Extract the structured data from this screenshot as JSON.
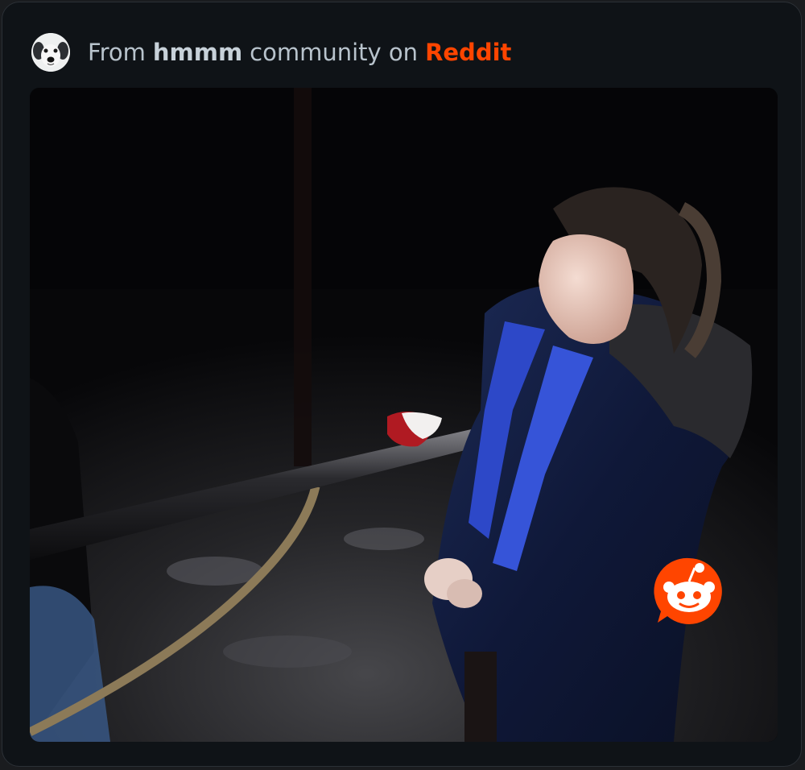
{
  "header": {
    "prefix": "From",
    "community": "hmmm",
    "middle": "community on",
    "platform": "Reddit"
  },
  "icons": {
    "avatar": "dog-face-avatar-icon",
    "badge": "reddit-snoo-icon"
  },
  "colors": {
    "background": "#0f1317",
    "text": "#b8c3cc",
    "brand": "#ff4500"
  }
}
